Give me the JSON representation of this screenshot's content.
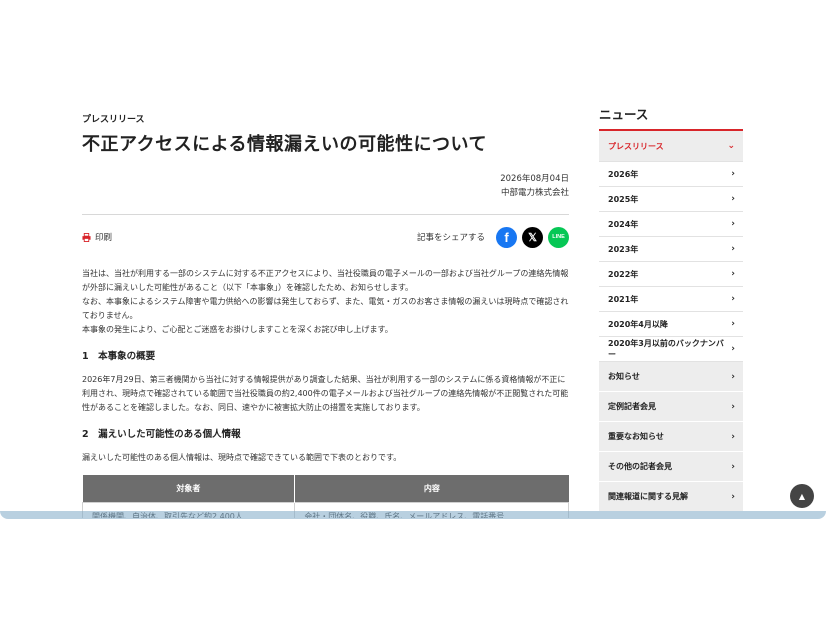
{
  "article": {
    "category": "プレスリリース",
    "title": "不正アクセスによる情報漏えいの可能性について",
    "date": "2026年08月04日",
    "publisher": "中部電力株式会社",
    "print_label": "印刷",
    "share_label": "記事をシェアする",
    "share_buttons": {
      "facebook_glyph": "f",
      "x_glyph": "𝕏",
      "line_glyph": "LINE"
    },
    "intro": [
      "当社は、当社が利用する一部のシステムに対する不正アクセスにより、当社役職員の電子メールの一部および当社グループの連絡先情報が外部に漏えいした可能性があること（以下「本事象」）を確認したため、お知らせします。",
      "なお、本事象によるシステム障害や電力供給への影響は発生しておらず、また、電気・ガスのお客さま情報の漏えいは現時点で確認されておりません。",
      "本事象の発生により、ご心配とご迷惑をお掛けしますことを深くお詫び申し上げます。"
    ],
    "section1_heading": "1　本事象の概要",
    "section1_text": "2026年7月29日、第三者機関から当社に対する情報提供があり調査した結果、当社が利用する一部のシステムに係る資格情報が不正に利用され、現時点で確認されている範囲で当社役職員の約2,400件の電子メールおよび当社グループの連絡先情報が不正閲覧された可能性があることを確認しました。なお、同日、速やかに被害拡大防止の措置を実施しております。",
    "section2_heading": "2　漏えいした可能性のある個人情報",
    "section2_text": "漏えいした可能性のある個人情報は、現時点で確認できている範囲で下表のとおりです。",
    "table": {
      "headers": [
        "対象者",
        "内容"
      ],
      "rows": [
        [
          "関係機関、自治体、取引先など約2,400人",
          "会社・団体名、役職、氏名、メールアドレス、電話番号"
        ]
      ]
    }
  },
  "sidebar": {
    "title": "ニュース",
    "active_item": "プレスリリース",
    "years": [
      "2026年",
      "2025年",
      "2024年",
      "2023年",
      "2022年",
      "2021年",
      "2020年4月以降",
      "2020年3月以前のバックナンバー"
    ],
    "categories": [
      "お知らせ",
      "定例記者会見",
      "重要なお知らせ",
      "その他の記者会見",
      "関連報道に関する見解"
    ]
  },
  "colors": {
    "accent": "#d8252a",
    "facebook": "#1877f2",
    "line": "#06c755",
    "table_header": "#6d6d6d"
  },
  "icons": {
    "print": "printer-icon",
    "page_top": "chevron-up-icon",
    "chevron": "chevron-right-icon"
  }
}
